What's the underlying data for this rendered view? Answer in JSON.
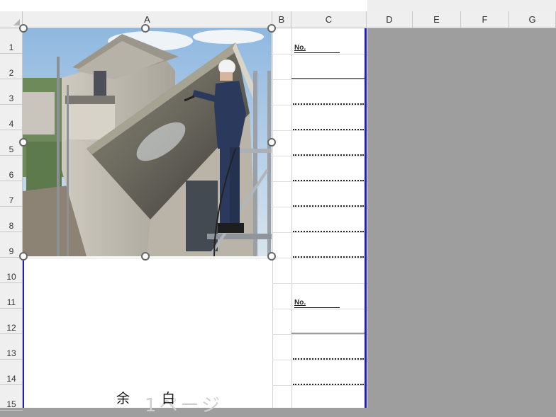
{
  "columns": [
    "A",
    "B",
    "C",
    "D",
    "E",
    "F",
    "G"
  ],
  "rows": [
    "1",
    "2",
    "3",
    "4",
    "5",
    "6",
    "7",
    "8",
    "9",
    "10",
    "11",
    "12",
    "13",
    "14",
    "15"
  ],
  "cells": {
    "c1_label": "No.",
    "c11_label": "No."
  },
  "body_text": {
    "yohaku_1": "余",
    "yohaku_2": "白"
  },
  "watermark": "1ページ",
  "picture": {
    "icon": "house-roof-photo",
    "selected": true
  },
  "colors": {
    "print_border": "#1f1fbf",
    "outside_area": "#9e9e9e",
    "header_bg": "#efefef"
  }
}
